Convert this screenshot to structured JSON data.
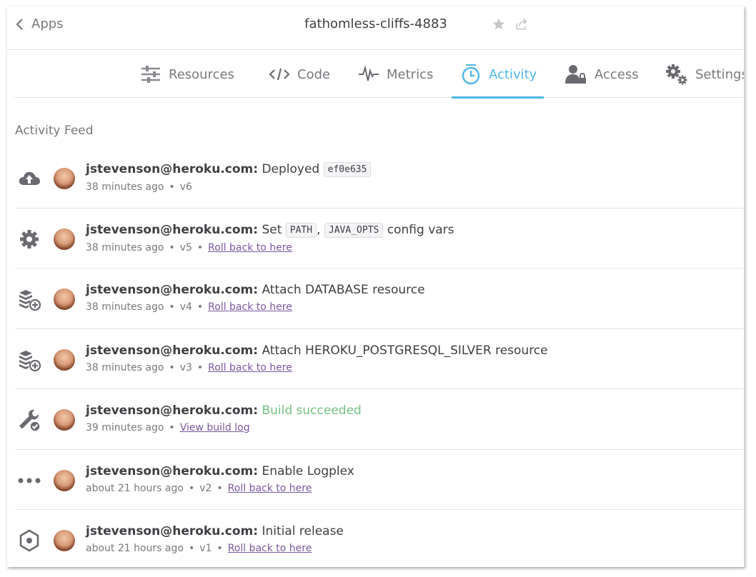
{
  "header": {
    "back_label": "Apps",
    "app_name": "fathomless-cliffs-4883"
  },
  "nav": {
    "tabs": [
      {
        "label": "Resources",
        "icon": "resources-icon"
      },
      {
        "label": "Code",
        "icon": "code-icon"
      },
      {
        "label": "Metrics",
        "icon": "metrics-icon"
      },
      {
        "label": "Activity",
        "icon": "activity-icon",
        "active": true
      },
      {
        "label": "Access",
        "icon": "access-icon"
      },
      {
        "label": "Settings",
        "icon": "settings-icon"
      }
    ]
  },
  "feed": {
    "title": "Activity Feed",
    "items": [
      {
        "icon": "deploy-icon",
        "user": "jstevenson@heroku.com:",
        "pre": "Deployed",
        "code1": "ef0e635",
        "time": "38 minutes ago",
        "version": "v6"
      },
      {
        "icon": "settings-icon",
        "user": "jstevenson@heroku.com:",
        "pre": "Set",
        "code1": "PATH",
        "comma": ",",
        "code2": "JAVA_OPTS",
        "post": "config vars",
        "time": "38 minutes ago",
        "version": "v5",
        "link": "Roll back to here"
      },
      {
        "icon": "addon-icon",
        "user": "jstevenson@heroku.com:",
        "pre": "Attach DATABASE resource",
        "time": "38 minutes ago",
        "version": "v4",
        "link": "Roll back to here"
      },
      {
        "icon": "addon-icon",
        "user": "jstevenson@heroku.com:",
        "pre": "Attach HEROKU_POSTGRESQL_SILVER resource",
        "time": "38 minutes ago",
        "version": "v3",
        "link": "Roll back to here"
      },
      {
        "icon": "build-icon",
        "user": "jstevenson@heroku.com:",
        "success": "Build succeeded",
        "time": "39 minutes ago",
        "link": "View build log"
      },
      {
        "icon": "more-icon",
        "user": "jstevenson@heroku.com:",
        "pre": "Enable Logplex",
        "time": "about 21 hours ago",
        "version": "v2",
        "link": "Roll back to here"
      },
      {
        "icon": "release-icon",
        "user": "jstevenson@heroku.com:",
        "pre": "Initial release",
        "time": "about 21 hours ago",
        "version": "v1",
        "link": "Roll back to here"
      }
    ]
  },
  "colors": {
    "accent": "#4fb7e8",
    "link": "#79589f",
    "success": "#74c080",
    "muted": "#79797f"
  }
}
